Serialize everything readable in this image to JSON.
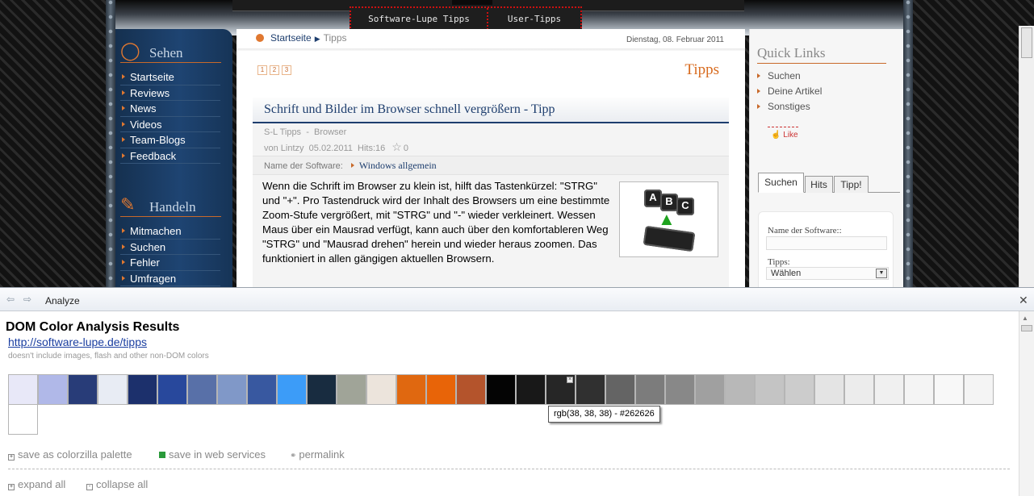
{
  "mainnav": {
    "items": [
      "Software-Lupe Tipps",
      "User-Tipps"
    ]
  },
  "leftnav": {
    "sehen": {
      "title": "Sehen",
      "items": [
        "Startseite",
        "Reviews",
        "News",
        "Videos",
        "Team-Blogs",
        "Feedback"
      ]
    },
    "handeln": {
      "title": "Handeln",
      "items": [
        "Mitmachen",
        "Suchen",
        "Fehler",
        "Umfragen"
      ]
    }
  },
  "content": {
    "breadcrumb": {
      "home": "Startseite",
      "current": "Tipps"
    },
    "date": "Dienstag, 08. Februar 2011",
    "pages": [
      "1",
      "2",
      "3"
    ],
    "section_title": "Tipps",
    "article": {
      "title": "Schrift und Bilder im Browser schnell vergrößern - Tipp",
      "category": "S-L Tipps",
      "dash": "-",
      "subcategory": "Browser",
      "author": "von Lintzy",
      "date": "05.02.2011",
      "hits": "Hits:16",
      "rating": "0",
      "software_label": "Name der Software:",
      "software_value": "Windows allgemein",
      "body": "Wenn die Schrift im Browser zu klein ist, hilft das Tastenkürzel: \"STRG\" und \"+\". Pro Tastendruck wird der Inhalt des Browsers um eine bestimmte Zoom-Stufe vergrößert, mit \"STRG\" und \"-\" wieder verkleinert. Wessen Maus über ein Mausrad verfügt, kann auch über den komfortableren Weg \"STRG\" und \"Mausrad drehen\" herein und wieder heraus zoomen. Das funktioniert in allen gängigen aktuellen Browsern.",
      "image_keys": [
        "A",
        "B",
        "C"
      ]
    }
  },
  "rightcol": {
    "quick_links_title": "Quick Links",
    "quick_links": [
      "Suchen",
      "Deine Artikel",
      "Sonstiges"
    ],
    "like": "Like",
    "tabs": [
      "Suchen",
      "Hits",
      "Tipp!"
    ],
    "search_form": {
      "software_label": "Name der Software::",
      "tips_label": "Tipps:",
      "tips_selected": "Wählen"
    }
  },
  "panel": {
    "title": "Analyze",
    "results_title": "DOM Color Analysis Results",
    "url": "http://software-lupe.de/tipps",
    "note": "doesn't include images, flash and other non-DOM colors",
    "colors": [
      "#e8e8f8",
      "#b0b8e8",
      "#283c78",
      "#e8ecf4",
      "#1c306c",
      "#28489c",
      "#5870a8",
      "#8098c8",
      "#3858a0",
      "#3c9cf8",
      "#182c40",
      "#a0a498",
      "#ece4dc",
      "#e06810",
      "#e86408",
      "#b4542c",
      "#040404",
      "#181818",
      "#262626",
      "#303030",
      "#646464",
      "#7c7c7c",
      "#888888",
      "#a0a0a0",
      "#b8b8b8",
      "#c4c4c4",
      "#cccccc",
      "#e4e4e4",
      "#ececec",
      "#f0f0f0",
      "#f4f4f4",
      "#f8f8f8",
      "#f4f4f4",
      "#ffffff"
    ],
    "tooltip": "rgb(38, 38, 38) - #262626",
    "actions": {
      "save_palette": "save as colorzilla palette",
      "save_web": "save in web services",
      "permalink": "permalink",
      "expand_all": "expand all",
      "collapse_all": "collapse all"
    }
  }
}
